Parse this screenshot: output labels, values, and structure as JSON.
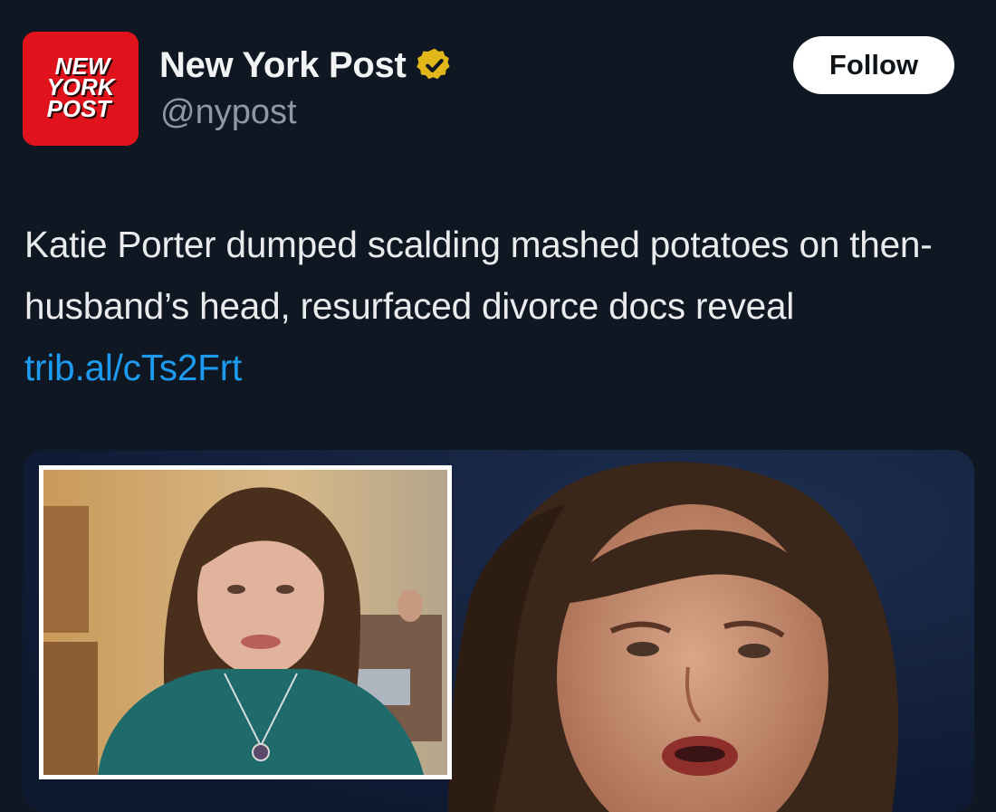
{
  "account": {
    "display_name": "New York Post",
    "handle": "@nypost",
    "avatar_logo_lines": [
      "NEW",
      "YORK",
      "POST"
    ],
    "verified_icon": "verified-badge-icon",
    "verified_color": "#e2b719"
  },
  "follow_button": {
    "label": "Follow"
  },
  "tweet": {
    "text": "Katie Porter dumped scalding mashed potatoes on then-husband’s head, resurfaced divorce docs reveal",
    "link": "trib.al/cTs2Frt",
    "link_color": "#1d9bf0"
  },
  "colors": {
    "background": "#0f1723",
    "avatar_red": "#e0121b",
    "handle_gray": "#8b98a5"
  }
}
